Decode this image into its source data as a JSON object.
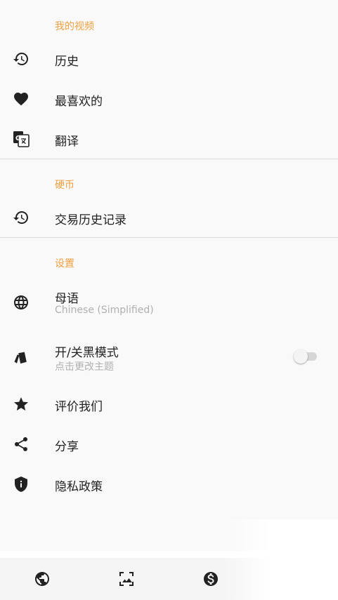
{
  "sections": {
    "videos": {
      "header": "我的视频",
      "history": "历史",
      "favorites": "最喜欢的",
      "translate": "翻译"
    },
    "coins": {
      "header": "硬币",
      "transactions": "交易历史记录"
    },
    "settings": {
      "header": "设置",
      "native_language": "母语",
      "native_language_value": "Chinese (Simplified)",
      "dark_mode": "开/关黑模式",
      "dark_mode_sub": "点击更改主题",
      "dark_mode_enabled": false,
      "rate": "评价我们",
      "share": "分享",
      "privacy": "隐私政策"
    }
  },
  "icons": {
    "history": "history-icon",
    "favorites": "heart-icon",
    "translate": "google-translate-icon",
    "transactions": "history-icon",
    "native_language": "globe-icon",
    "dark_mode": "cards-icon",
    "rate": "star-icon",
    "share": "share-icon",
    "privacy": "shield-icon"
  },
  "bottom_nav": [
    "earth-icon",
    "image-icon",
    "dollar-coin-icon"
  ],
  "colors": {
    "section_header": "#f0a040",
    "text": "#222222",
    "subtext": "#b0b0b0",
    "drawer_bg": "#f9f9f9"
  }
}
